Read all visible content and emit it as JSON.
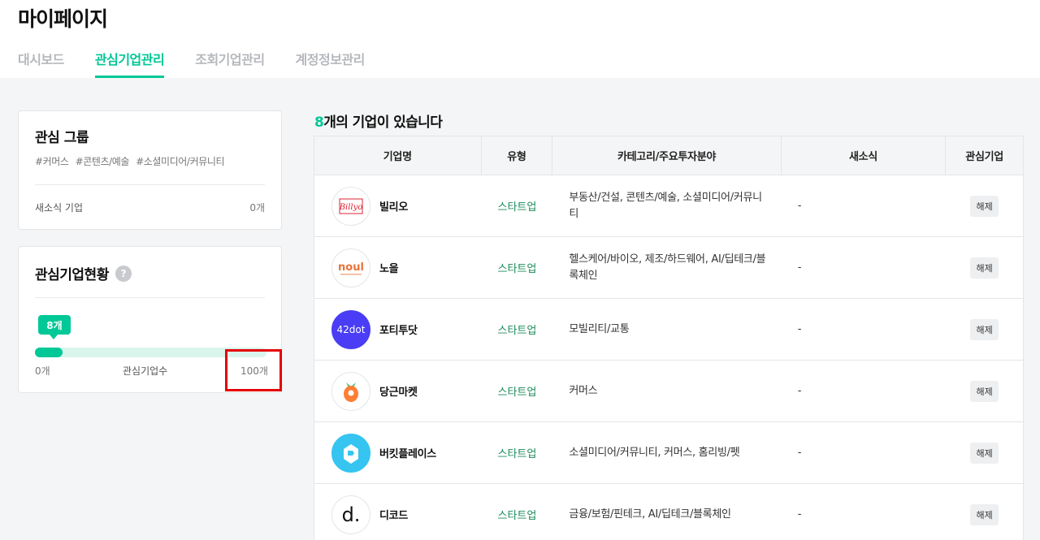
{
  "page": {
    "title": "마이페이지"
  },
  "tabs": [
    {
      "label": "대시보드",
      "active": false
    },
    {
      "label": "관심기업관리",
      "active": true
    },
    {
      "label": "조회기업관리",
      "active": false
    },
    {
      "label": "계정정보관리",
      "active": false
    }
  ],
  "interest_group": {
    "title": "관심 그룹",
    "tags": [
      "#커머스",
      "#콘텐츠/예술",
      "#소셜미디어/커뮤니티"
    ],
    "news_label": "새소식 기업",
    "news_count": "0개"
  },
  "interest_status": {
    "title": "관심기업현황",
    "help_icon": "question-circle-icon",
    "current_label": "8개",
    "current": 8,
    "max": 100,
    "min_label": "0개",
    "bar_label": "관심기업수",
    "max_label": "100개"
  },
  "list": {
    "count_num": "8",
    "count_suffix": "개의 기업이 있습니다",
    "headers": [
      "기업명",
      "유형",
      "카테고리/주요투자분야",
      "새소식",
      "관심기업"
    ],
    "rows": [
      {
        "name": "빌리오",
        "type": "스타트업",
        "category": "부동산/건설, 콘텐츠/예술, 소셜미디어/커뮤니티",
        "news": "-",
        "action": "해제",
        "logo": "billyo-logo"
      },
      {
        "name": "노을",
        "type": "스타트업",
        "category": "헬스케어/바이오, 제조/하드웨어, AI/딥테크/블록체인",
        "news": "-",
        "action": "해제",
        "logo": "noul-logo"
      },
      {
        "name": "포티투닷",
        "type": "스타트업",
        "category": "모빌리티/교통",
        "news": "-",
        "action": "해제",
        "logo": "42dot-logo"
      },
      {
        "name": "당근마켓",
        "type": "스타트업",
        "category": "커머스",
        "news": "-",
        "action": "해제",
        "logo": "carrot-logo"
      },
      {
        "name": "버킷플레이스",
        "type": "스타트업",
        "category": "소셜미디어/커뮤니티, 커머스, 홈리빙/펫",
        "news": "-",
        "action": "해제",
        "logo": "bucketplace-logo"
      },
      {
        "name": "디코드",
        "type": "스타트업",
        "category": "금융/보험/핀테크, AI/딥테크/블록체인",
        "news": "-",
        "action": "해제",
        "logo": "dcode-logo"
      }
    ]
  },
  "colors": {
    "accent": "#00c896",
    "highlight": "#e60000"
  }
}
